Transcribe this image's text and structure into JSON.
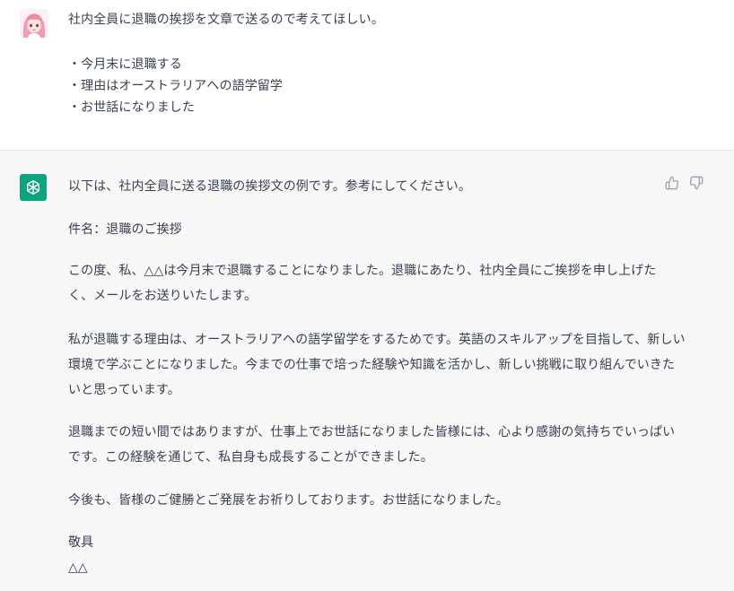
{
  "user_message": {
    "lines": [
      "社内全員に退職の挨拶を文章で送るので考えてほしい。",
      "・今月末に退職する",
      "・理由はオーストラリアへの語学留学",
      "・お世話になりました"
    ]
  },
  "assistant_message": {
    "lines": [
      "以下は、社内全員に送る退職の挨拶文の例です。参考にしてください。",
      "件名：退職のご挨拶",
      "この度、私、△△は今月末で退職することになりました。退職にあたり、社内全員にご挨拶を申し上げた",
      "く、メールをお送りいたします。",
      "私が退職する理由は、オーストラリアへの語学留学をするためです。英語のスキルアップを目指して、新しい",
      "環境で学ぶことになりました。今までの仕事で培った経験や知識を活かし、新しい挑戦に取り組んでいきた",
      "いと思っています。",
      "退職までの短い間ではありますが、仕事上でお世話になりました皆様には、心より感謝の気持ちでいっぱい",
      "です。この経験を通じて、私自身も成長することができました。",
      "今後も、皆様のご健勝とご発展をお祈りしております。お世話になりました。",
      "敬具",
      "△△"
    ]
  },
  "icons": {
    "user_avatar": "user-avatar-illustration",
    "assistant_avatar": "openai-logo-icon",
    "like": "thumbs-up-icon",
    "dislike": "thumbs-down-icon"
  },
  "colors": {
    "assistant_avatar_bg": "#10a37f",
    "assistant_bg": "#f7f7f8",
    "text": "#374151",
    "icon": "#9ca3af"
  }
}
